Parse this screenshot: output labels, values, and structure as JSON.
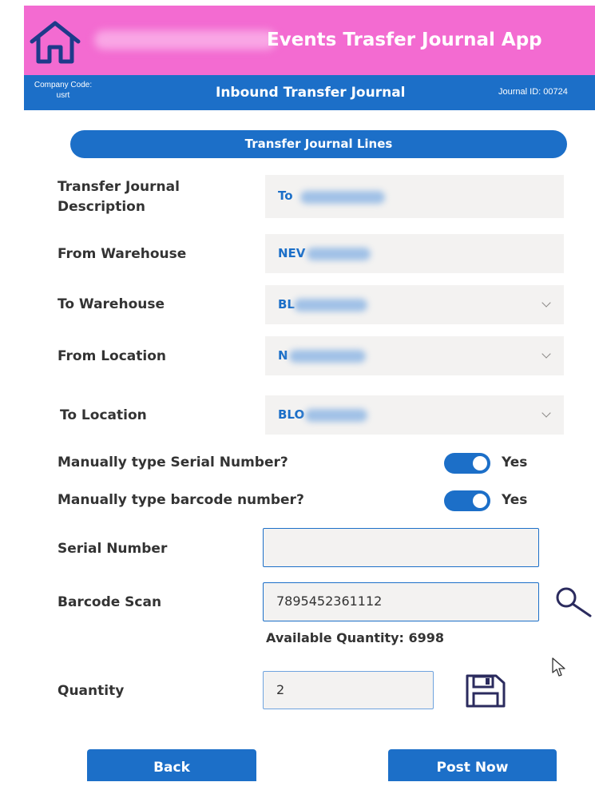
{
  "header": {
    "app_title": "Events Trasfer Journal App",
    "home_icon": "home-icon"
  },
  "subheader": {
    "company_code_label": "Company Code:",
    "company_code_value": "usrt",
    "title": "Inbound Transfer Journal",
    "journal_id": "Journal ID: 00724"
  },
  "section": {
    "title": "Transfer Journal Lines"
  },
  "fields": {
    "description": {
      "label_line1": "Transfer Journal",
      "label_line2": "Description",
      "value": "To"
    },
    "from_warehouse": {
      "label": "From Warehouse",
      "value": "NEV"
    },
    "to_warehouse": {
      "label": "To Warehouse",
      "value": "BL"
    },
    "from_location": {
      "label": "From Location",
      "value": "N"
    },
    "to_location": {
      "label": "To Location",
      "value": "BLO"
    }
  },
  "toggles": {
    "serial": {
      "label": "Manually type Serial Number?",
      "state": "Yes"
    },
    "barcode": {
      "label": "Manually type barcode number?",
      "state": "Yes"
    }
  },
  "serial_number": {
    "label": "Serial Number",
    "value": ""
  },
  "barcode_scan": {
    "label": "Barcode Scan",
    "value": "7895452361112"
  },
  "available_quantity": "Available Quantity: 6998",
  "quantity": {
    "label": "Quantity",
    "value": "2"
  },
  "buttons": {
    "back": "Back",
    "post_now": "Post Now"
  },
  "colors": {
    "header_pink": "#f36bd1",
    "accent_blue": "#1c6fc8",
    "field_bg": "#f3f2f1"
  }
}
